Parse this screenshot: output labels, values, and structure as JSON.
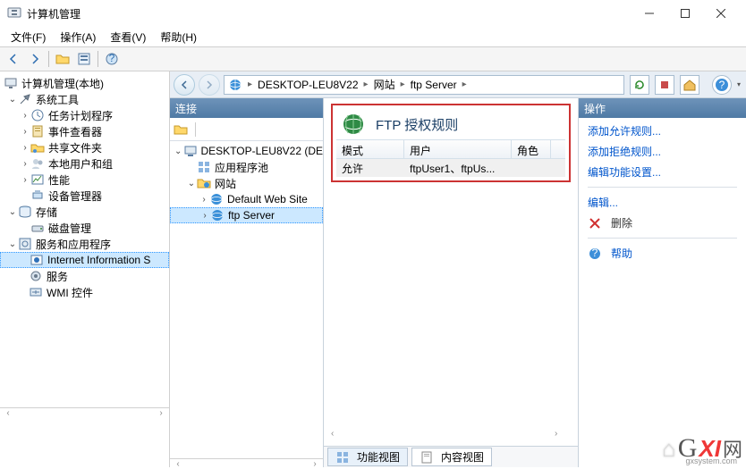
{
  "titlebar": {
    "title": "计算机管理"
  },
  "menubar": {
    "file": "文件(F)",
    "action": "操作(A)",
    "view": "查看(V)",
    "help": "帮助(H)"
  },
  "left_tree": {
    "root": "计算机管理(本地)",
    "system_tools": "系统工具",
    "task_scheduler": "任务计划程序",
    "event_viewer": "事件查看器",
    "shared_folders": "共享文件夹",
    "local_users": "本地用户和组",
    "performance": "性能",
    "device_manager": "设备管理器",
    "storage": "存储",
    "disk_management": "磁盘管理",
    "services_apps": "服务和应用程序",
    "iis": "Internet Information Services",
    "iis_display": "Internet Information S",
    "services": "服务",
    "wmi": "WMI 控件"
  },
  "address": {
    "server": "DESKTOP-LEU8V22",
    "sites": "网站",
    "ftp": "ftp Server"
  },
  "connections": {
    "header": "连接",
    "server": "DESKTOP-LEU8V22 (DE",
    "app_pools": "应用程序池",
    "sites": "网站",
    "default_site": "Default Web Site",
    "ftp_server": "ftp Server"
  },
  "center": {
    "title": "FTP 授权规则",
    "col_mode": "模式",
    "col_user": "用户",
    "col_role": "角色",
    "row_mode": "允许",
    "row_user": "ftpUser1、ftpUs...",
    "row_role": ""
  },
  "tabs": {
    "features": "功能视图",
    "content": "内容视图"
  },
  "actions": {
    "header": "操作",
    "add_allow": "添加允许规则...",
    "add_deny": "添加拒绝规则...",
    "feature_settings": "编辑功能设置...",
    "edit": "编辑...",
    "delete": "删除",
    "help": "帮助"
  },
  "watermark": {
    "brand": "GXI",
    "wang": "网",
    "domain": "gxsystem.com"
  }
}
